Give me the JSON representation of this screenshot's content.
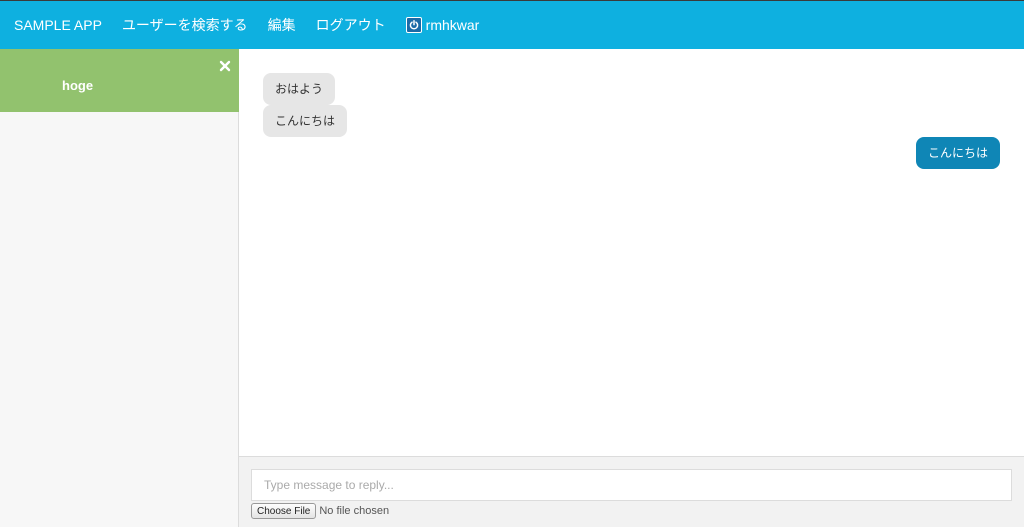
{
  "navbar": {
    "brand": "SAMPLE APP",
    "search_users": "ユーザーを検索する",
    "edit": "編集",
    "logout": "ログアウト",
    "username": "rmhkwar"
  },
  "sidebar": {
    "rooms": [
      {
        "name": "hoge",
        "active": true
      }
    ]
  },
  "messages": [
    {
      "text": "おはよう",
      "direction": "incoming"
    },
    {
      "text": "こんにちは",
      "direction": "incoming"
    },
    {
      "text": "こんにちは",
      "direction": "outgoing"
    }
  ],
  "reply": {
    "placeholder": "Type message to reply...",
    "choose_file": "Choose File",
    "file_status": "No file chosen"
  },
  "colors": {
    "navbar": "#0eb0e0",
    "active_room": "#92c26e",
    "outgoing_bubble": "#0f86b6",
    "incoming_bubble": "#e6e6e6"
  },
  "icons": {
    "user": "power-icon",
    "close_room": "close-icon"
  }
}
